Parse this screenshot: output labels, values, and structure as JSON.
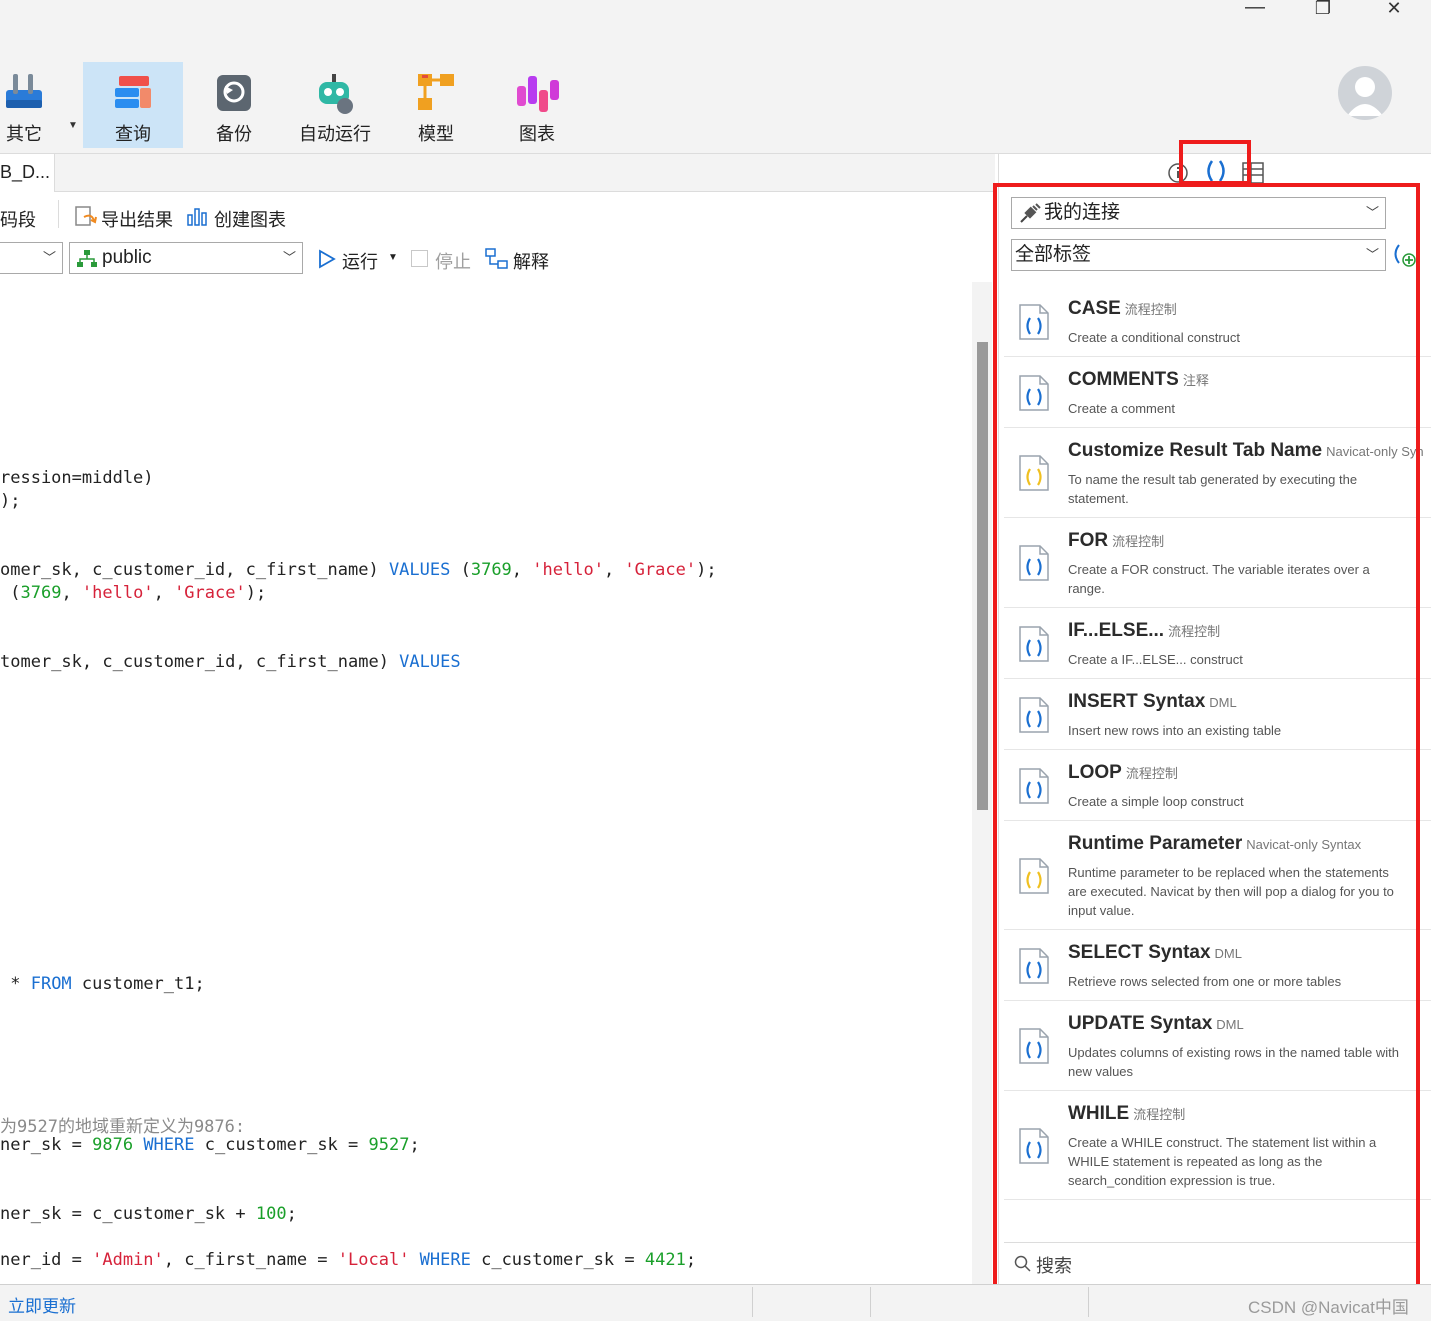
{
  "window": {
    "minimize": "—",
    "restore": "❐",
    "close": "✕"
  },
  "ribbon": {
    "items": [
      {
        "label": "其它",
        "icon": "tools-icon"
      },
      {
        "label": "查询",
        "icon": "query-icon"
      },
      {
        "label": "备份",
        "icon": "backup-icon"
      },
      {
        "label": "自动运行",
        "icon": "robot-icon"
      },
      {
        "label": "模型",
        "icon": "model-icon"
      },
      {
        "label": "图表",
        "icon": "chart-icon"
      }
    ],
    "active": "查询"
  },
  "editor_tab": {
    "title": "B_D..."
  },
  "toolbar": {
    "field_label": "码段",
    "export_label": "导出结果",
    "create_chart_label": "创建图表",
    "schema_value": "public",
    "run_label": "运行",
    "stop_label": "停止",
    "explain_label": "解释"
  },
  "code": {
    "l1": "ression=middle)",
    "l2": ");",
    "l3a": "omer_sk, c_customer_id, c_first_name) ",
    "l3kw": "VALUES",
    "l3b": " (",
    "l3n": "3769",
    "l3c": ", ",
    "l3s1": "'hello'",
    "l3d": ", ",
    "l3s2": "'Grace'",
    "l3e": ");",
    "l4a": " (",
    "l4n": "3769",
    "l4b": ", ",
    "l4s1": "'hello'",
    "l4c": ", ",
    "l4s2": "'Grace'",
    "l4d": ");",
    "l5a": "tomer_sk, c_customer_id, c_first_name) ",
    "l5kw": "VALUES",
    "l6a": " * ",
    "l6kw": "FROM",
    "l6b": " customer_t1;",
    "l7cmt": "为9527的地域重新定义为9876:",
    "l8a": "ner_sk = ",
    "l8n1": "9876",
    "l8kw": " WHERE",
    "l8b": " c_customer_sk = ",
    "l8n2": "9527",
    "l8c": ";",
    "l9a": "ner_sk = c_customer_sk + ",
    "l9n": "100",
    "l9b": ";",
    "l10a": "ner_id = ",
    "l10s1": "'Admin'",
    "l10b": ", c_first_name = ",
    "l10s2": "'Local'",
    "l10kw": " WHERE",
    "l10c": " c_customer_sk = ",
    "l10n": "4421",
    "l10d": ";"
  },
  "panel": {
    "connection": "我的连接",
    "tags": "全部标签",
    "search_placeholder": "搜索",
    "snippets": [
      {
        "title": "CASE",
        "tag": "流程控制",
        "desc": "Create a conditional construct",
        "kind": "blue"
      },
      {
        "title": "COMMENTS",
        "tag": "注释",
        "desc": "Create a comment",
        "kind": "blue"
      },
      {
        "title": "Customize Result Tab Name",
        "tag": "Navicat-only Syn",
        "desc": "To name the result tab generated by executing the statement.",
        "kind": "yellow"
      },
      {
        "title": "FOR",
        "tag": "流程控制",
        "desc": "Create a FOR construct. The variable iterates over a range.",
        "kind": "blue"
      },
      {
        "title": "IF...ELSE...",
        "tag": "流程控制",
        "desc": "Create a IF...ELSE... construct",
        "kind": "blue"
      },
      {
        "title": "INSERT Syntax",
        "tag": "DML",
        "desc": "Insert new rows into an existing table",
        "kind": "blue"
      },
      {
        "title": "LOOP",
        "tag": "流程控制",
        "desc": "Create a simple loop construct",
        "kind": "blue"
      },
      {
        "title": "Runtime Parameter",
        "tag": "Navicat-only Syntax",
        "desc": "Runtime parameter to be replaced when the statements are executed. Navicat by then will pop a dialog for you to input value.",
        "kind": "yellow"
      },
      {
        "title": "SELECT Syntax",
        "tag": "DML",
        "desc": "Retrieve rows selected from one or more tables",
        "kind": "blue"
      },
      {
        "title": "UPDATE Syntax",
        "tag": "DML",
        "desc": "Updates columns of existing rows in the named table with new values",
        "kind": "blue"
      },
      {
        "title": "WHILE",
        "tag": "流程控制",
        "desc": "Create a WHILE construct. The statement list within a WHILE statement is repeated as long as the search_condition expression is true.",
        "kind": "blue"
      }
    ]
  },
  "status": {
    "update_link": "立即更新",
    "watermark": "CSDN @Navicat中国"
  },
  "colors": {
    "highlight": "#ee1c1c",
    "keyword": "#1a6fd1",
    "number": "#1a9f2a",
    "string": "#d6223a",
    "active_tab": "#cce4f7"
  }
}
